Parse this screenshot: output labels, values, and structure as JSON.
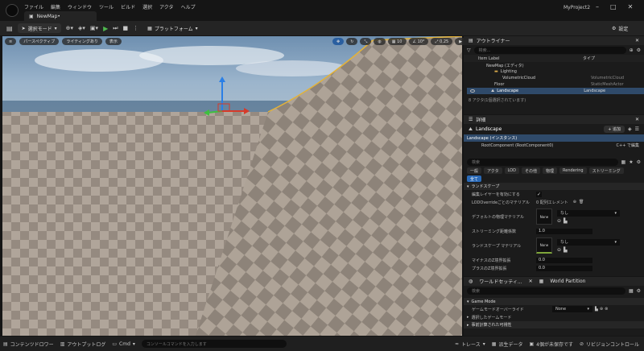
{
  "app": {
    "project_name": "MyProject2",
    "tab_title": "NewMap•",
    "menu": [
      "ファイル",
      "編集",
      "ウィンドウ",
      "ツール",
      "ビルド",
      "選択",
      "アクタ",
      "ヘルプ"
    ]
  },
  "toolbar": {
    "mode_label": "選択モード",
    "platform_label": "プラットフォーム",
    "settings_label": "設定"
  },
  "viewport": {
    "perspective": "パースペクティブ",
    "lighting": "ライティングあり",
    "show": "表示",
    "grid_snap": "10",
    "rot_snap": "10°",
    "scale_snap": "0.25",
    "cam_speed": "1"
  },
  "outliner": {
    "title": "アウトライナー",
    "search_placeholder": "検索...",
    "col_label": "Item Label",
    "col_type": "タイプ",
    "rows": [
      {
        "label": "NewMap (エディタ)",
        "type": "",
        "indent": 1
      },
      {
        "label": "Lighting",
        "type": "",
        "indent": 2
      },
      {
        "label": "VolumetricCloud",
        "type": "VolumetricCloud",
        "indent": 3
      },
      {
        "label": "Floor",
        "type": "StaticMeshActor",
        "indent": 2
      },
      {
        "label": "Landscape",
        "type": "Landscape",
        "indent": 2,
        "selected": true
      }
    ],
    "footer": "8 アクタ(1個選択されています)"
  },
  "details": {
    "title": "詳細",
    "object_name": "Landscape",
    "add_label": "+ 追加",
    "instance_label": "Landscape (インスタンス)",
    "root_component": "RootComponent (RootComponent0)",
    "edit_cpp": "C++ で編集",
    "search_placeholder": "検索",
    "categories": [
      "一般",
      "アクタ",
      "LOD",
      "その他",
      "物理",
      "Rendering",
      "ストリーミング"
    ],
    "all_label": "全て",
    "section": "ランドスケープ",
    "props": {
      "edit_layer_label": "編集レイヤーを有効にする",
      "lod_override_label": "LODOverrideごとのマテリアル",
      "lod_override_value": "0 配列エレメント",
      "default_phys_label": "デフォルトの物理マテリアル",
      "none_thumb": "None",
      "none_dropdown": "なし",
      "streaming_dist_label": "ストリーミング距離係数",
      "streaming_dist_value": "1.0",
      "landscape_mat_label": "ランドスケープ マテリアル",
      "neg_z_label": "マイナスのZ境界拡張",
      "neg_z_value": "0.0",
      "pos_z_label": "プラスのZ境界拡張",
      "pos_z_value": "0.0"
    }
  },
  "world": {
    "tab1": "ワールドセッティ...",
    "tab2": "World Partition",
    "search_placeholder": "検索",
    "game_mode_section": "Game Mode",
    "game_mode_override_label": "ゲームモードオーバーライド",
    "game_mode_override_value": "None",
    "selected_game_mode": "選択したゲームモード",
    "precomputed_visibility": "事前計算された可視性"
  },
  "status": {
    "content_drawer": "コンテンツドロワー",
    "output_log": "アウトプットログ",
    "cmd": "Cmd",
    "cmd_placeholder": "コンソールコマンドを入力します",
    "trace": "トレース",
    "derived_data": "派生データ",
    "unsaved": "4個が未保存です",
    "revision": "リビジョンコントロール"
  }
}
